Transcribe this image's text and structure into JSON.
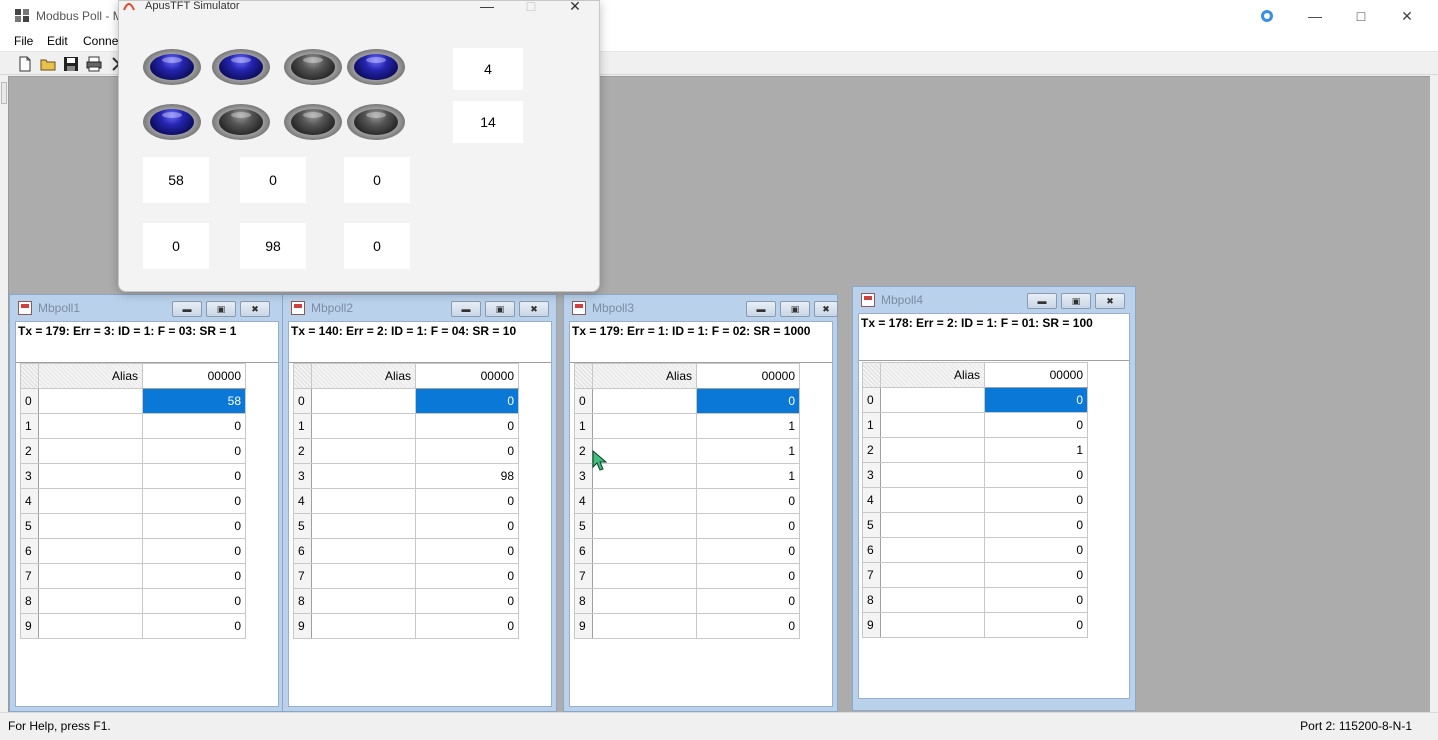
{
  "main_window": {
    "title": "Modbus Poll - M",
    "menu": [
      "File",
      "Edit",
      "Conne"
    ],
    "status_help": "For Help, press F1.",
    "status_port": "Port 2: 115200-8-N-1"
  },
  "simulator": {
    "title": "ApusTFT Simulator",
    "leds_row1": [
      "on",
      "on",
      "off",
      "on"
    ],
    "leds_row2": [
      "on",
      "off",
      "off",
      "off"
    ],
    "box_right_1": "4",
    "box_right_2": "14",
    "row3": [
      "58",
      "0",
      "0"
    ],
    "row4": [
      "0",
      "98",
      "0"
    ]
  },
  "children": [
    {
      "name": "Mbpoll1",
      "status": "Tx = 179: Err = 3: ID = 1: F = 03: SR = 1",
      "col_alias": "Alias",
      "col_addr": "00000",
      "rows": [
        {
          "idx": "0",
          "val": "58"
        },
        {
          "idx": "1",
          "val": "0"
        },
        {
          "idx": "2",
          "val": "0"
        },
        {
          "idx": "3",
          "val": "0"
        },
        {
          "idx": "4",
          "val": "0"
        },
        {
          "idx": "5",
          "val": "0"
        },
        {
          "idx": "6",
          "val": "0"
        },
        {
          "idx": "7",
          "val": "0"
        },
        {
          "idx": "8",
          "val": "0"
        },
        {
          "idx": "9",
          "val": "0"
        }
      ]
    },
    {
      "name": "Mbpoll2",
      "status": "Tx = 140: Err = 2: ID = 1: F = 04: SR = 10",
      "col_alias": "Alias",
      "col_addr": "00000",
      "rows": [
        {
          "idx": "0",
          "val": "0"
        },
        {
          "idx": "1",
          "val": "0"
        },
        {
          "idx": "2",
          "val": "0"
        },
        {
          "idx": "3",
          "val": "98"
        },
        {
          "idx": "4",
          "val": "0"
        },
        {
          "idx": "5",
          "val": "0"
        },
        {
          "idx": "6",
          "val": "0"
        },
        {
          "idx": "7",
          "val": "0"
        },
        {
          "idx": "8",
          "val": "0"
        },
        {
          "idx": "9",
          "val": "0"
        }
      ]
    },
    {
      "name": "Mbpoll3",
      "status": "Tx = 179: Err = 1: ID = 1: F = 02: SR = 1000",
      "col_alias": "Alias",
      "col_addr": "00000",
      "rows": [
        {
          "idx": "0",
          "val": "0"
        },
        {
          "idx": "1",
          "val": "1"
        },
        {
          "idx": "2",
          "val": "1"
        },
        {
          "idx": "3",
          "val": "1"
        },
        {
          "idx": "4",
          "val": "0"
        },
        {
          "idx": "5",
          "val": "0"
        },
        {
          "idx": "6",
          "val": "0"
        },
        {
          "idx": "7",
          "val": "0"
        },
        {
          "idx": "8",
          "val": "0"
        },
        {
          "idx": "9",
          "val": "0"
        }
      ]
    },
    {
      "name": "Mbpoll4",
      "status": "Tx = 178: Err = 2: ID = 1: F = 01: SR = 100",
      "col_alias": "Alias",
      "col_addr": "00000",
      "rows": [
        {
          "idx": "0",
          "val": "0"
        },
        {
          "idx": "1",
          "val": "0"
        },
        {
          "idx": "2",
          "val": "1"
        },
        {
          "idx": "3",
          "val": "0"
        },
        {
          "idx": "4",
          "val": "0"
        },
        {
          "idx": "5",
          "val": "0"
        },
        {
          "idx": "6",
          "val": "0"
        },
        {
          "idx": "7",
          "val": "0"
        },
        {
          "idx": "8",
          "val": "0"
        },
        {
          "idx": "9",
          "val": "0"
        }
      ]
    }
  ],
  "colors": {
    "selection": "#0a78d7",
    "mdi_background": "#acacac",
    "led_on": "#2525b0"
  }
}
